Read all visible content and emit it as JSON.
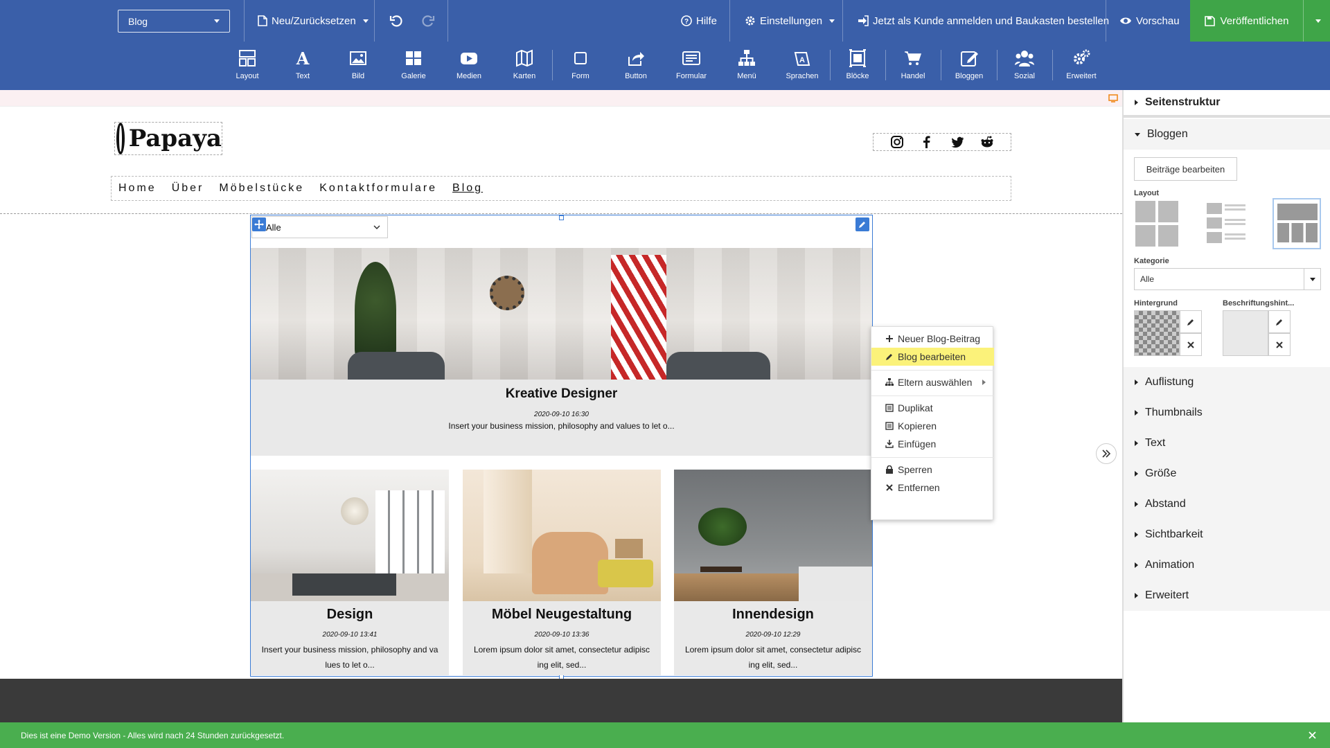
{
  "topbar": {
    "page_select": "Blog",
    "new_reset": "Neu/Zurücksetzen",
    "help": "Hilfe",
    "settings": "Einstellungen",
    "login_order": "Jetzt als Kunde anmelden und Baukasten bestellen",
    "preview": "Vorschau",
    "publish": "Veröffentlichen"
  },
  "toolbar": [
    {
      "label": "Layout",
      "icon": "layout-icon"
    },
    {
      "label": "Text",
      "icon": "text-icon"
    },
    {
      "label": "Bild",
      "icon": "image-icon"
    },
    {
      "label": "Galerie",
      "icon": "gallery-icon"
    },
    {
      "label": "Medien",
      "icon": "media-icon"
    },
    {
      "label": "Karten",
      "icon": "map-icon"
    },
    {
      "label": "Form",
      "icon": "form-shape-icon"
    },
    {
      "label": "Button",
      "icon": "share-icon"
    },
    {
      "label": "Formular",
      "icon": "formular-icon"
    },
    {
      "label": "Menü",
      "icon": "sitemap-icon"
    },
    {
      "label": "Sprachen",
      "icon": "language-icon"
    },
    {
      "label": "Blöcke",
      "icon": "blocks-icon"
    },
    {
      "label": "Handel",
      "icon": "cart-icon"
    },
    {
      "label": "Bloggen",
      "icon": "blog-edit-icon"
    },
    {
      "label": "Sozial",
      "icon": "users-icon"
    },
    {
      "label": "Erweitert",
      "icon": "cogs-icon"
    }
  ],
  "site": {
    "logo_text": "Papaya",
    "nav": [
      "Home",
      "Über",
      "Möbelstücke",
      "Kontaktformulare",
      "Blog"
    ],
    "category_select": "Alle"
  },
  "blog": {
    "featured": {
      "title": "Kreative Designer",
      "date": "2020-09-10 16:30",
      "excerpt": "Insert your business mission, philosophy and values to let o..."
    },
    "posts": [
      {
        "title": "Design",
        "date": "2020-09-10 13:41",
        "line1": "Insert your business mission, philosophy and va",
        "line2": "lues to let o..."
      },
      {
        "title": "Möbel Neugestaltung",
        "date": "2020-09-10 13:36",
        "line1": "Lorem ipsum dolor sit amet, consectetur adipisc",
        "line2": "ing elit, sed..."
      },
      {
        "title": "Innendesign",
        "date": "2020-09-10 12:29",
        "line1": "Lorem ipsum dolor sit amet, consectetur adipisc",
        "line2": "ing elit, sed..."
      }
    ]
  },
  "context_menu": {
    "new_post": "Neuer Blog-Beitrag",
    "edit_blog": "Blog bearbeiten",
    "select_parent": "Eltern auswählen",
    "duplicate": "Duplikat",
    "copy": "Kopieren",
    "paste": "Einfügen",
    "lock": "Sperren",
    "remove": "Entfernen"
  },
  "panel": {
    "structure": "Seitenstruktur",
    "bloggen": "Bloggen",
    "edit_posts": "Beiträge bearbeiten",
    "layout_label": "Layout",
    "category_label": "Kategorie",
    "category_value": "Alle",
    "background_label": "Hintergrund",
    "caption_bg_label": "Beschriftungshint...",
    "sections": [
      "Auflistung",
      "Thumbnails",
      "Text",
      "Größe",
      "Abstand",
      "Sichtbarkeit",
      "Animation",
      "Erweitert"
    ]
  },
  "demo_notice": "Dies ist eine Demo Version - Alles wird nach 24 Stunden zurückgesetzt.",
  "colors": {
    "accent": "#3a5fa9",
    "publish": "#3fa548",
    "highlight": "#fbf27a",
    "demo_bar": "#4aae4f"
  }
}
